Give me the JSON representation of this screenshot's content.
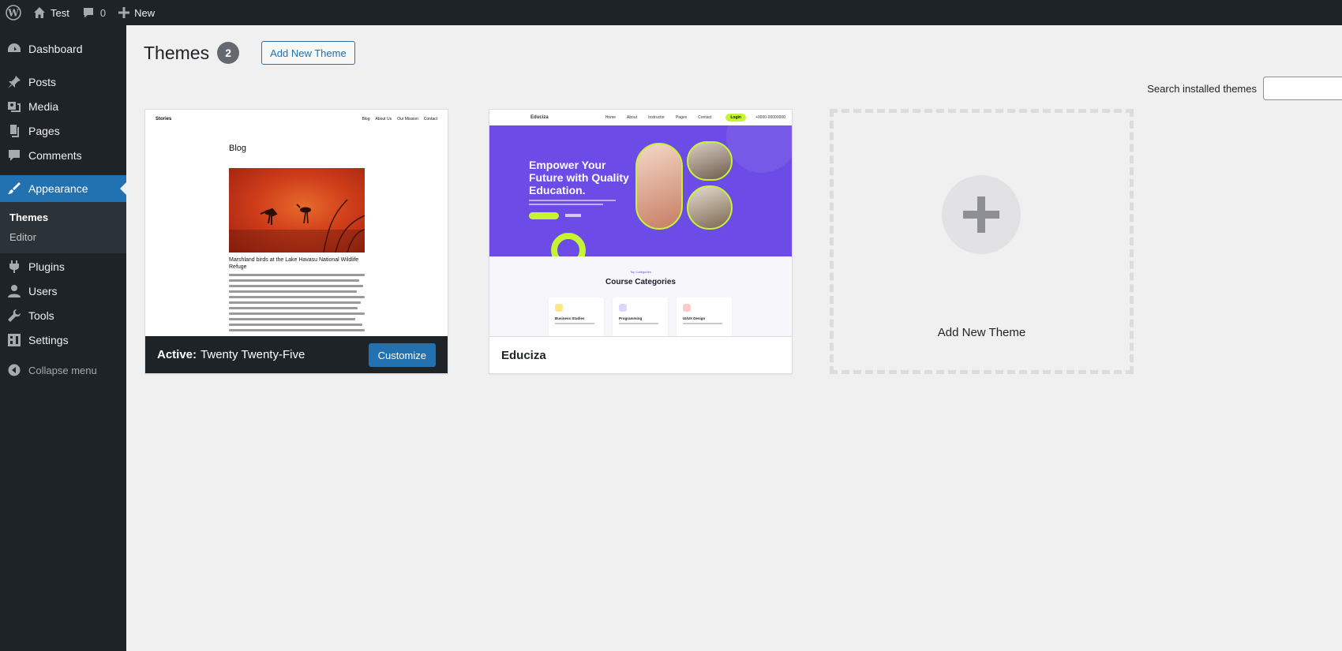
{
  "admin_bar": {
    "site_name": "Test",
    "comments_count": "0",
    "new_label": "New"
  },
  "sidebar": {
    "items": [
      {
        "label": "Dashboard",
        "icon": "dashboard-icon"
      },
      {
        "label": "Posts",
        "icon": "pin-icon"
      },
      {
        "label": "Media",
        "icon": "media-icon"
      },
      {
        "label": "Pages",
        "icon": "pages-icon"
      },
      {
        "label": "Comments",
        "icon": "comment-icon"
      },
      {
        "label": "Appearance",
        "icon": "brush-icon",
        "active": true
      },
      {
        "label": "Plugins",
        "icon": "plug-icon"
      },
      {
        "label": "Users",
        "icon": "user-icon"
      },
      {
        "label": "Tools",
        "icon": "wrench-icon"
      },
      {
        "label": "Settings",
        "icon": "settings-icon"
      }
    ],
    "submenu": [
      "Themes",
      "Editor"
    ],
    "collapse_label": "Collapse menu"
  },
  "page": {
    "title": "Themes",
    "count": "2",
    "add_new_label": "Add New Theme",
    "search_label": "Search installed themes",
    "search_value": ""
  },
  "themes": [
    {
      "active_prefix": "Active:",
      "name": "Twenty Twenty-Five",
      "customize_label": "Customize",
      "preview": {
        "site_title": "Stories",
        "nav": [
          "Blog",
          "About Us",
          "Our Mission",
          "Contact"
        ],
        "heading": "Blog",
        "post_title": "Marshland birds at the Lake Havasu National Wildlife Refuge"
      }
    },
    {
      "name": "Educiza",
      "preview": {
        "logo": "Educiza",
        "nav": [
          "Home",
          "About",
          "Instructor",
          "Pages",
          "Contact"
        ],
        "login": "Login",
        "phone": "+0000-00000000",
        "hero_title": "Empower Your Future with Quality Education.",
        "section_small": "Top Categories",
        "section_title": "Course Categories",
        "cards": [
          "Business Studies",
          "Programming",
          "UI/UX Design"
        ]
      }
    }
  ],
  "add_tile": {
    "label": "Add New Theme"
  },
  "colors": {
    "accent": "#2271b1",
    "admin_dark": "#1d2327",
    "background": "#f0f0f1",
    "educiza_purple": "#6c4be6",
    "educiza_lime": "#c6f432"
  }
}
